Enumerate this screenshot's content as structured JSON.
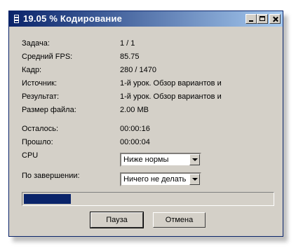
{
  "window": {
    "title": "19.05 % Кодирование"
  },
  "rows": [
    {
      "label": "Задача:",
      "value": "1 / 1"
    },
    {
      "label": "Средний FPS:",
      "value": "85.75"
    },
    {
      "label": "Кадр:",
      "value": "280 / 1470"
    },
    {
      "label": "Источник:",
      "value": "1-й урок. Обзор вариантов и"
    },
    {
      "label": "Результат:",
      "value": "1-й урок. Обзор вариантов и"
    },
    {
      "label": "Размер файла:",
      "value": "2.00 MB"
    },
    {
      "label": "Осталось:",
      "value": "00:00:16"
    },
    {
      "label": "Прошло:",
      "value": "00:00:04"
    }
  ],
  "cpu": {
    "label": "CPU",
    "selected": "Ниже нормы"
  },
  "on_finish": {
    "label": "По завершении:",
    "selected": "Ничего не делать"
  },
  "progress": {
    "percent": 19.05,
    "color": "#0a246a"
  },
  "buttons": {
    "pause": "Пауза",
    "cancel": "Отмена"
  },
  "icons": {
    "title_icon": "film-icon",
    "minimize": "minimize-icon",
    "maximize": "maximize-icon",
    "close": "close-icon"
  }
}
